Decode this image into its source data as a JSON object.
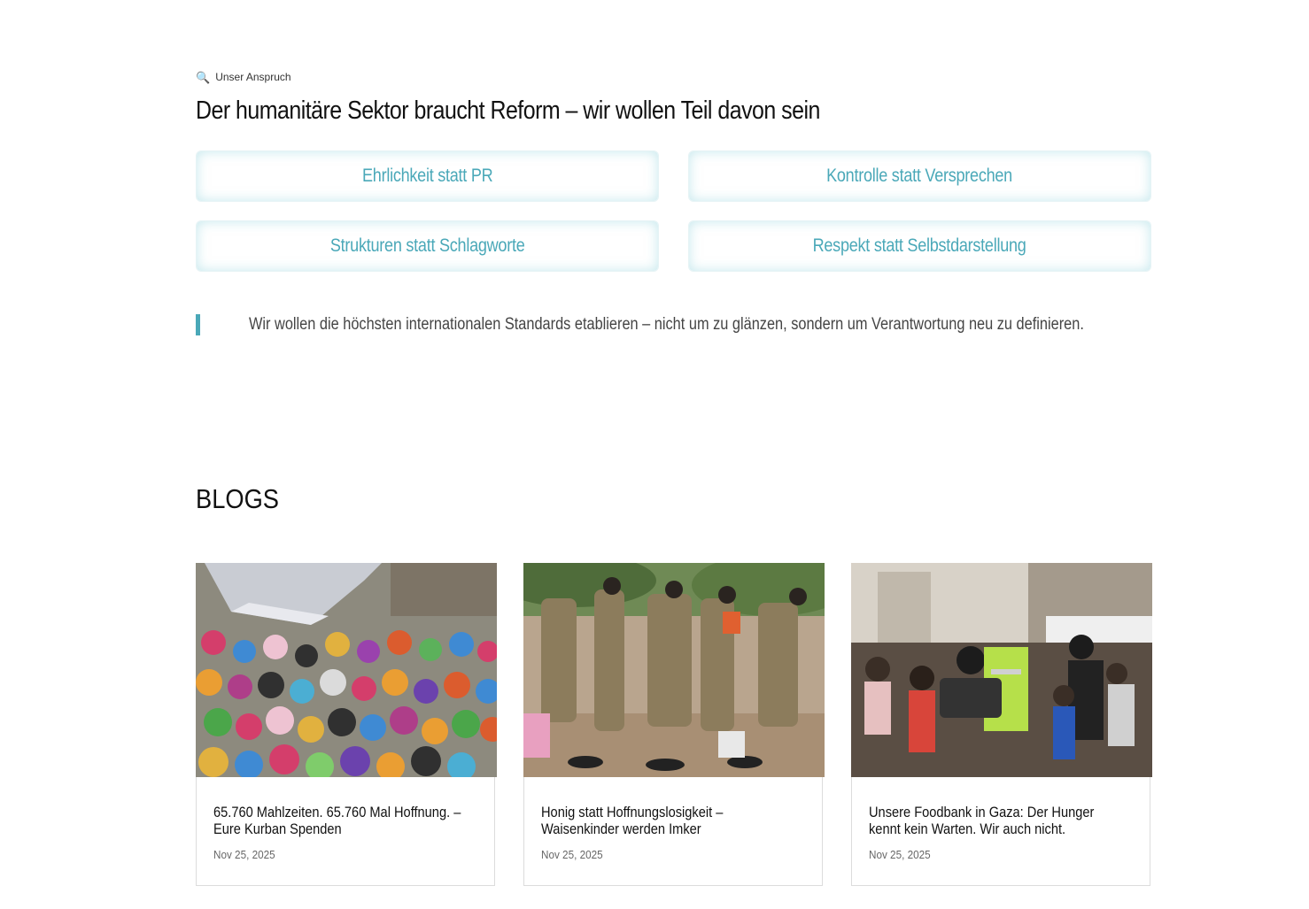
{
  "values_section": {
    "eyebrow_icon": "magnifier-icon",
    "eyebrow": "Unser Anspruch",
    "headline": "Der humanitäre Sektor braucht Reform – wir wollen Teil davon sein",
    "pills": [
      "Ehrlichkeit statt PR",
      "Kontrolle statt Versprechen",
      "Strukturen statt Schlagworte",
      "Respekt statt Selbstdarstellung"
    ],
    "quote": "Wir wollen die höchsten internationalen Standards etablieren – nicht um zu glänzen, sondern um Verantwortung neu zu definieren."
  },
  "blogs": {
    "title": "BLOGS",
    "cards": [
      {
        "title": "65.760 Mahlzeiten. 65.760 Mal Hoffnung. – Eure Kurban Spenden",
        "date": "Nov 25, 2025"
      },
      {
        "title": "Honig statt Hoffnungslosigkeit – Waisenkinder werden Imker",
        "date": "Nov 25, 2025"
      },
      {
        "title": "Unsere Foodbank in Gaza: Der Hunger kennt kein Warten. Wir auch nicht.",
        "date": "Nov 25, 2025"
      }
    ]
  },
  "colors": {
    "accent": "#4aa8b8",
    "text": "#111111",
    "muted": "#666666"
  }
}
